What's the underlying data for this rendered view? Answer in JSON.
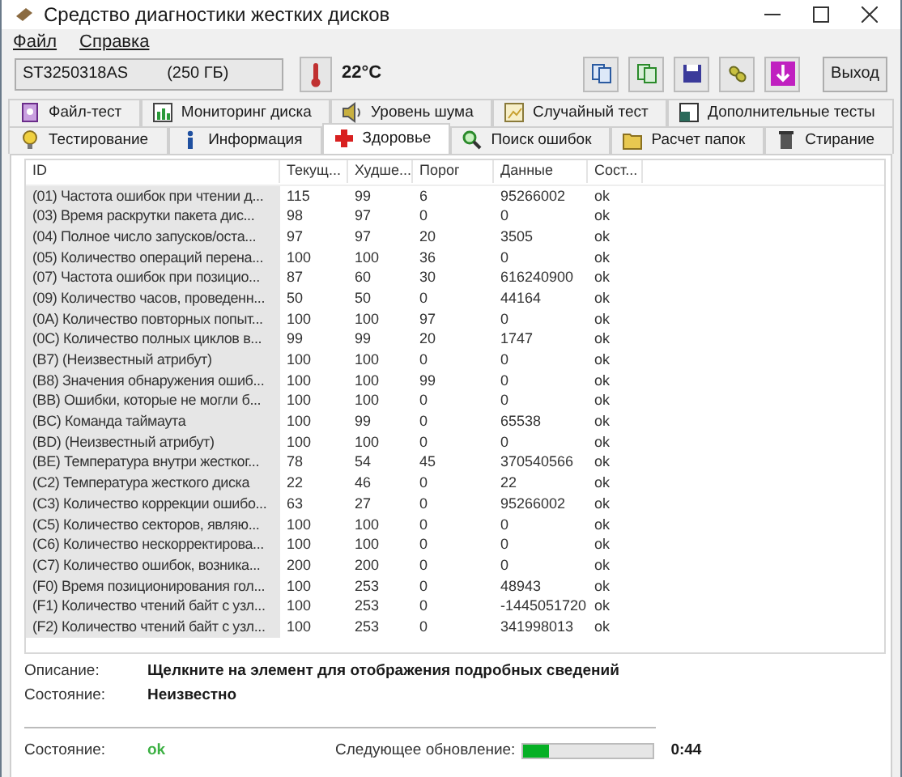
{
  "window": {
    "title": "Средство диагностики жестких дисков"
  },
  "menu": [
    "Файл",
    "Справка"
  ],
  "toolbar": {
    "drive": "ST3250318AS",
    "capacity": "(250 ГБ)",
    "temperature": "22°C",
    "exit": "Выход"
  },
  "tabs_top": [
    {
      "label": "Файл-тест",
      "selected": false
    },
    {
      "label": "Мониторинг диска",
      "selected": false
    },
    {
      "label": "Уровень шума",
      "selected": false
    },
    {
      "label": "Случайный тест",
      "selected": false
    },
    {
      "label": "Дополнительные тесты",
      "selected": false
    }
  ],
  "tabs_bottom": [
    {
      "label": "Тестирование",
      "selected": false
    },
    {
      "label": "Информация",
      "selected": false
    },
    {
      "label": "Здоровье",
      "selected": true
    },
    {
      "label": "Поиск ошибок",
      "selected": false
    },
    {
      "label": "Расчет папок",
      "selected": false
    },
    {
      "label": "Стирание",
      "selected": false
    }
  ],
  "table": {
    "columns": [
      "ID",
      "Текущ...",
      "Худше...",
      "Порог",
      "Данные",
      "Сост..."
    ],
    "rows": [
      [
        "(01) Частота ошибок при чтении д...",
        "115",
        "99",
        "6",
        "95266002",
        "ok"
      ],
      [
        "(03) Время раскрутки пакета дис...",
        "98",
        "97",
        "0",
        "0",
        "ok"
      ],
      [
        "(04) Полное число запусков/оста...",
        "97",
        "97",
        "20",
        "3505",
        "ok"
      ],
      [
        "(05) Количество операций перена...",
        "100",
        "100",
        "36",
        "0",
        "ok"
      ],
      [
        "(07) Частота ошибок при позицио...",
        "87",
        "60",
        "30",
        "616240900",
        "ok"
      ],
      [
        "(09) Количество часов, проведенн...",
        "50",
        "50",
        "0",
        "44164",
        "ok"
      ],
      [
        "(0A) Количество повторных попыт...",
        "100",
        "100",
        "97",
        "0",
        "ok"
      ],
      [
        "(0C) Количество полных циклов в...",
        "99",
        "99",
        "20",
        "1747",
        "ok"
      ],
      [
        "(B7) (Неизвестный атрибут)",
        "100",
        "100",
        "0",
        "0",
        "ok"
      ],
      [
        "(B8) Значения обнаружения ошиб...",
        "100",
        "100",
        "99",
        "0",
        "ok"
      ],
      [
        "(BB) Ошибки, которые не могли б...",
        "100",
        "100",
        "0",
        "0",
        "ok"
      ],
      [
        "(BC) Команда таймаута",
        "100",
        "99",
        "0",
        "65538",
        "ok"
      ],
      [
        "(BD) (Неизвестный атрибут)",
        "100",
        "100",
        "0",
        "0",
        "ok"
      ],
      [
        "(BE) Температура внутри жестког...",
        "78",
        "54",
        "45",
        "370540566",
        "ok"
      ],
      [
        "(C2) Температура жесткого диска",
        "22",
        "46",
        "0",
        "22",
        "ok"
      ],
      [
        "(C3) Количество коррекции ошибо...",
        "63",
        "27",
        "0",
        "95266002",
        "ok"
      ],
      [
        "(C5) Количество секторов, являю...",
        "100",
        "100",
        "0",
        "0",
        "ok"
      ],
      [
        "(C6) Количество нескорректирова...",
        "100",
        "100",
        "0",
        "0",
        "ok"
      ],
      [
        "(C7) Количество ошибок, возника...",
        "200",
        "200",
        "0",
        "0",
        "ok"
      ],
      [
        "(F0) Время позиционирования гол...",
        "100",
        "253",
        "0",
        "48943",
        "ok"
      ],
      [
        "(F1) Количество чтений байт с узл...",
        "100",
        "253",
        "0",
        "-1445051720",
        "ok"
      ],
      [
        "(F2) Количество чтений байт с узл...",
        "100",
        "253",
        "0",
        "341998013",
        "ok"
      ]
    ]
  },
  "details": [
    {
      "label": "Описание:",
      "value": "Щелкните на элемент для отображения подробных сведений"
    },
    {
      "label": "Состояние:",
      "value": "Неизвестно"
    }
  ],
  "status_bar": {
    "label": "Состояние:",
    "value": "ok",
    "next_label": "Следующее обновление:",
    "level": 0.2,
    "time": "0:44"
  }
}
